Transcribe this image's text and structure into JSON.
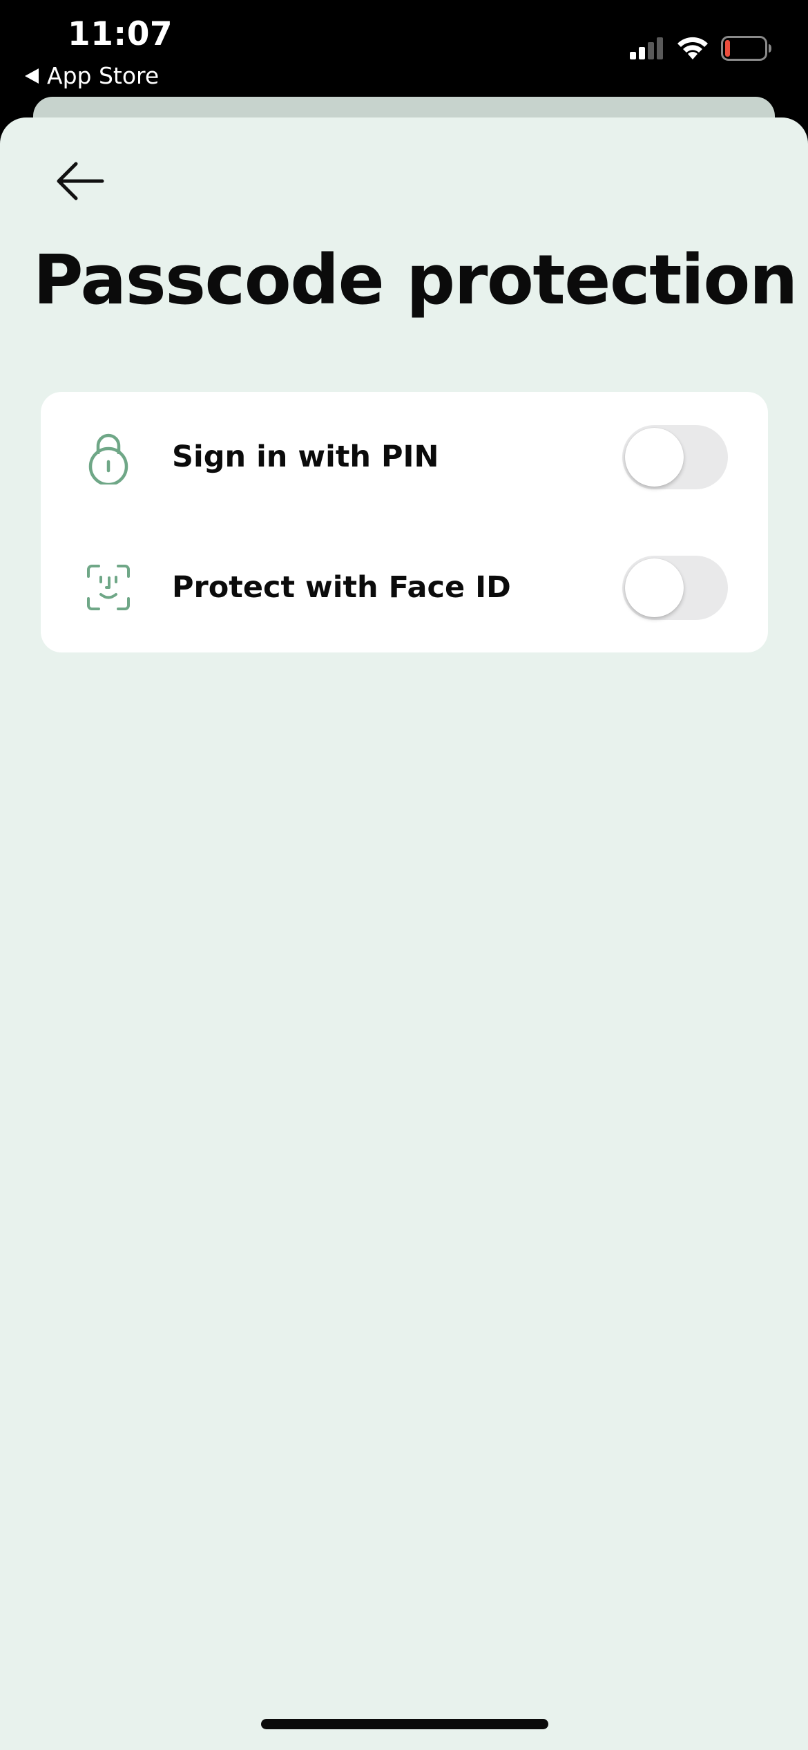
{
  "status_bar": {
    "time": "11:07",
    "back_app": "App Store",
    "signal_icon": "cellular-signal-icon",
    "wifi_icon": "wifi-icon",
    "battery_icon": "battery-low-icon",
    "battery_level": 0.12,
    "battery_color": "#eb4d3d"
  },
  "header": {
    "back_icon": "arrow-left-icon",
    "title": "Passcode protection"
  },
  "settings": [
    {
      "icon": "lock-icon",
      "label": "Sign in with PIN",
      "enabled": false
    },
    {
      "icon": "face-id-icon",
      "label": "Protect with Face ID",
      "enabled": false
    }
  ],
  "colors": {
    "sheet_background": "#e8f2ed",
    "icon_accent": "#6fa787",
    "toggle_off": "#e9e9ea"
  }
}
